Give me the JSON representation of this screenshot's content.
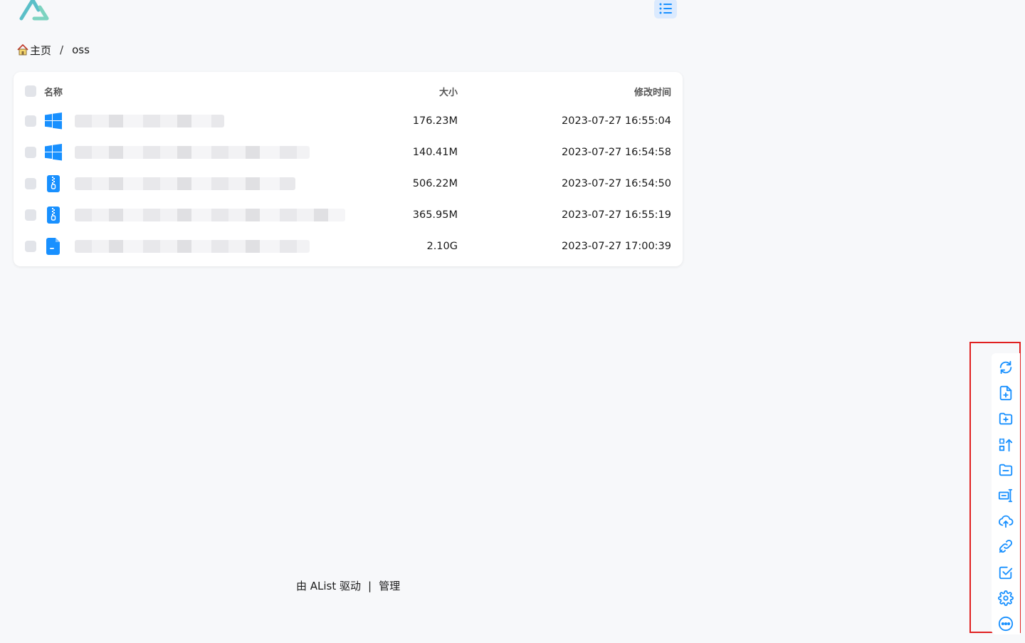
{
  "breadcrumb": {
    "home_label": "主页",
    "separator": "/",
    "current": "oss"
  },
  "table": {
    "headers": {
      "name": "名称",
      "size": "大小",
      "modified": "修改时间"
    },
    "rows": [
      {
        "icon": "windows-icon",
        "size": "176.23M",
        "modified": "2023-07-27 16:55:04"
      },
      {
        "icon": "windows-icon",
        "size": "140.41M",
        "modified": "2023-07-27 16:54:58"
      },
      {
        "icon": "zip-file-icon",
        "size": "506.22M",
        "modified": "2023-07-27 16:54:50"
      },
      {
        "icon": "zip-file-icon",
        "size": "365.95M",
        "modified": "2023-07-27 16:55:19"
      },
      {
        "icon": "document-icon",
        "size": "2.10G",
        "modified": "2023-07-27 17:00:39"
      }
    ]
  },
  "footer": {
    "powered_by": "由 AList 驱动",
    "divider": "|",
    "admin_link": "管理"
  },
  "toolbar": {
    "icons": [
      "refresh-icon",
      "new-file-icon",
      "new-folder-icon",
      "sort-icon",
      "folder-minus-icon",
      "rename-icon",
      "upload-cloud-icon",
      "link-icon",
      "checkbox-icon",
      "settings-icon",
      "more-icon"
    ]
  },
  "colors": {
    "accent": "#1890ff",
    "toggle_bg": "#dbeafe",
    "highlight_border": "#e02020",
    "logo": "#5bbfc8"
  }
}
